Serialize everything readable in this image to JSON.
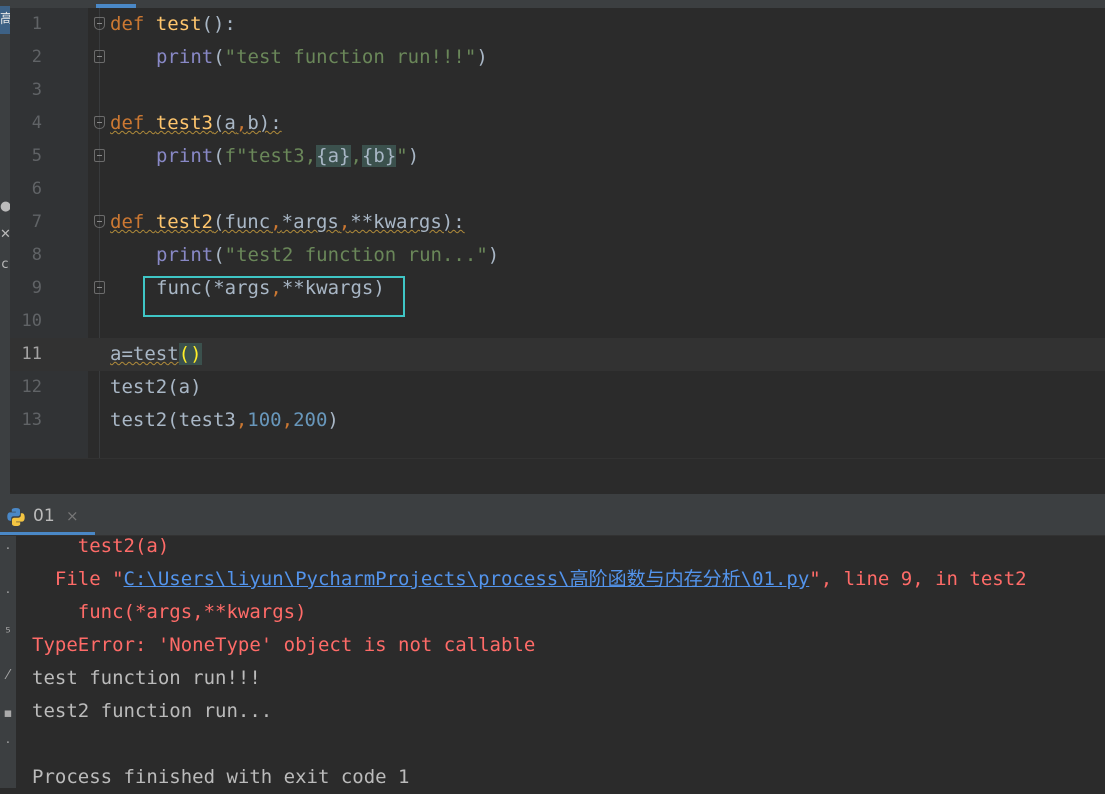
{
  "left_strip": {
    "glyphs": [
      "高",
      "✕",
      "c"
    ]
  },
  "editor": {
    "lines": [
      {
        "no": "1"
      },
      {
        "no": "2"
      },
      {
        "no": "3"
      },
      {
        "no": "4"
      },
      {
        "no": "5"
      },
      {
        "no": "6"
      },
      {
        "no": "7"
      },
      {
        "no": "8"
      },
      {
        "no": "9"
      },
      {
        "no": "10"
      },
      {
        "no": "11"
      },
      {
        "no": "12"
      },
      {
        "no": "13"
      }
    ],
    "tokens": {
      "def": "def",
      "test": "test",
      "paren_colon": "():",
      "print": "print",
      "l2_open": "(",
      "l2_str": "\"test function run!!!\"",
      "l2_close": ")",
      "test3": "test3",
      "l4_args": "(a",
      "comma": ",",
      "l4_b": "b):",
      "l5_open": "(",
      "l5_f": "f\"test3,",
      "l5_a": "{a}",
      "l5_comma": ",",
      "l5_b": "{b}",
      "l5_end": "\"",
      "l5_close": ")",
      "test2": "test2",
      "l7_a": "(func",
      "l7_b": "*args",
      "l7_c": "**kwargs):",
      "l8_open": "(",
      "l8_str": "\"test2 function run...\"",
      "l8_close": ")",
      "l9_a": "func(*args",
      "l9_b": "**kwargs)",
      "l11_a": "a=test",
      "l11_paren": "()",
      "l12": "test2(a)",
      "l13_a": "test2(test3",
      "l13_n1": "100",
      "l13_n2": "200",
      "l13_close": ")"
    }
  },
  "run_panel": {
    "tab_label": "01",
    "close_glyph": "×"
  },
  "console": {
    "line1": "    test2(a)",
    "line2_pre": "  File \"",
    "line2_link": "C:\\Users\\liyun\\PycharmProjects\\process\\高阶函数与内存分析\\01.py",
    "line2_post": "\", line 9, in test2",
    "line3": "    func(*args,**kwargs)",
    "line4": "TypeError: 'NoneType' object is not callable",
    "line5": "test function run!!!",
    "line6": "test2 function run...",
    "line7": "",
    "line8": "Process finished with exit code 1"
  },
  "colors": {
    "keyword": "#cc7832",
    "function": "#ffc66d",
    "string": "#6a8759",
    "number": "#6897bb",
    "error": "#ff6b68",
    "highlight_box": "#3fc6c6"
  }
}
